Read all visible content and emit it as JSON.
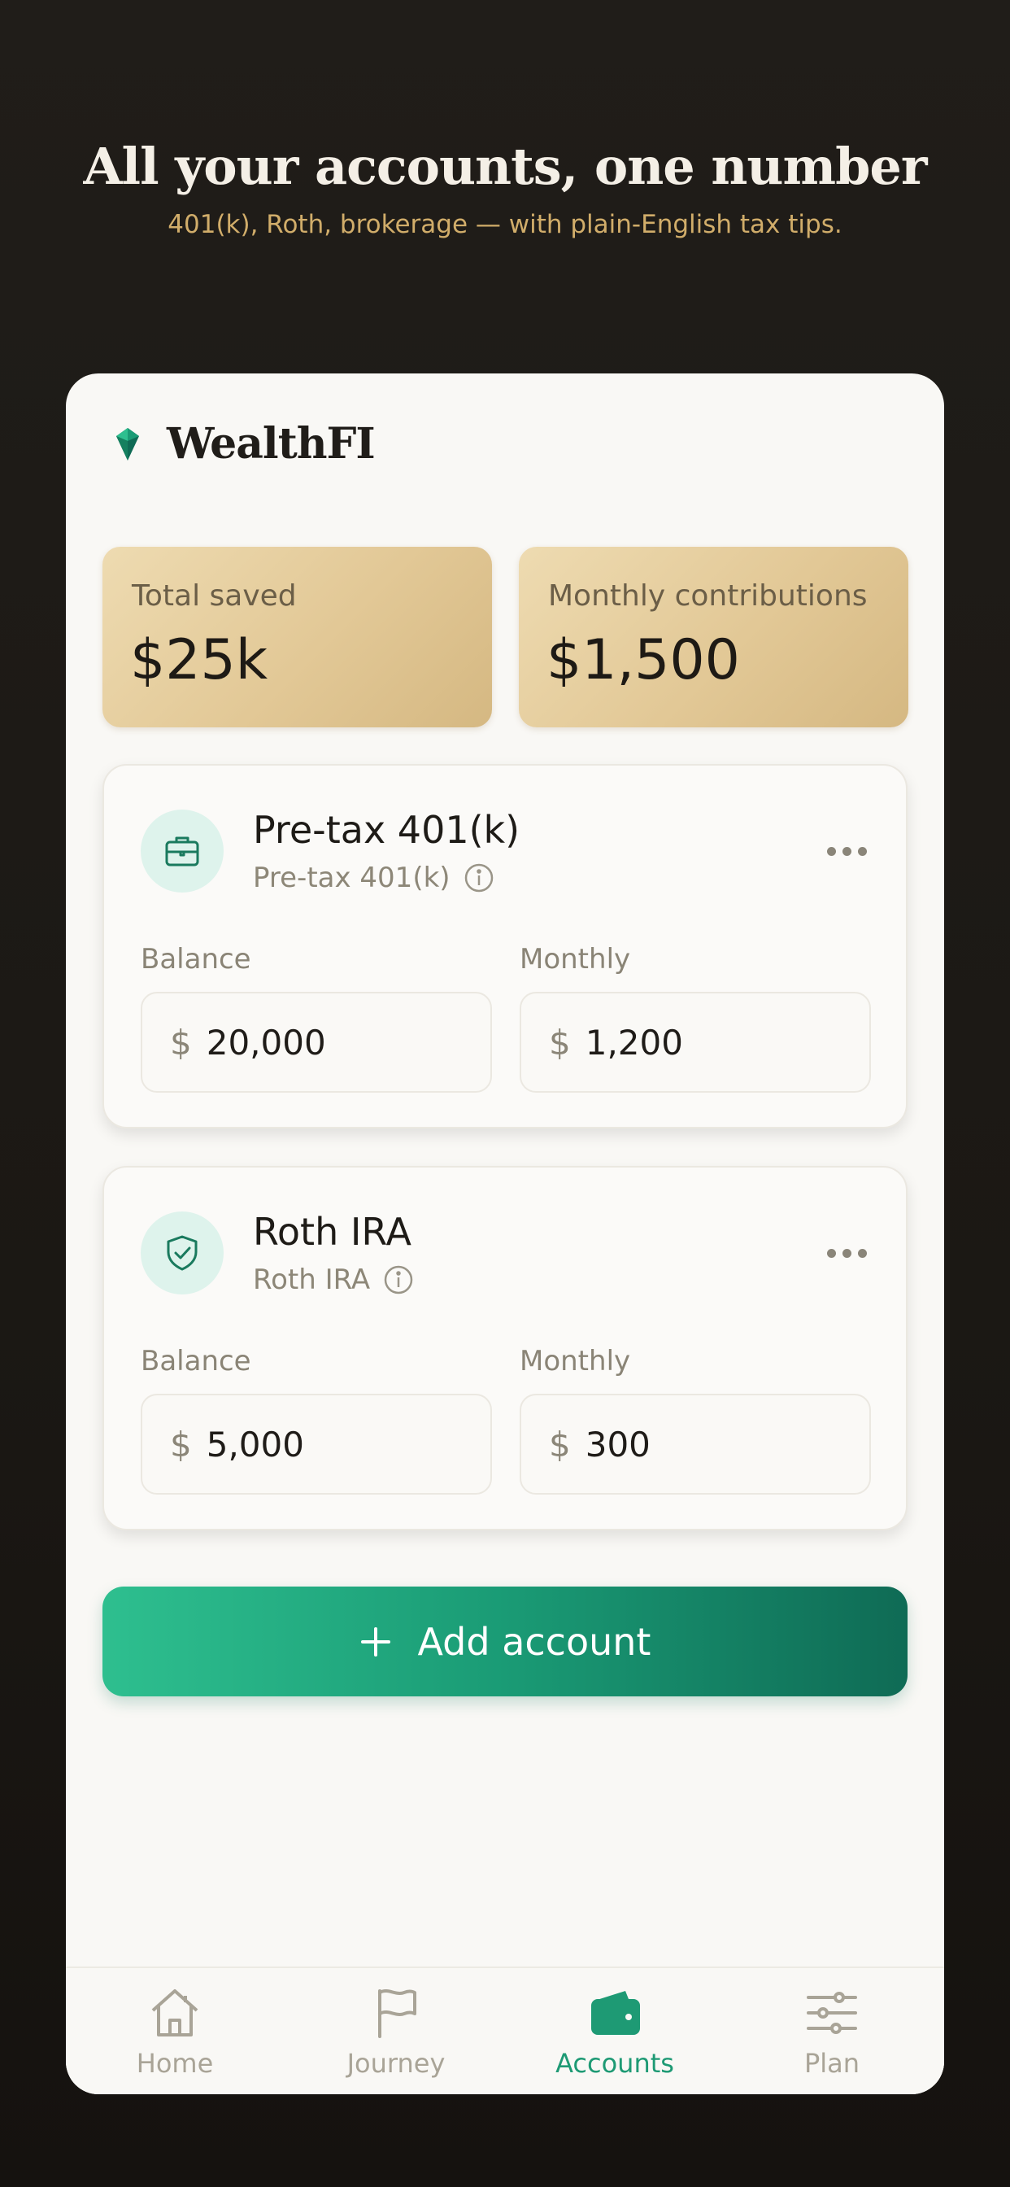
{
  "hero": {
    "title": "All your accounts, one number",
    "subtitle": "401(k), Roth, brokerage — with plain-English tax tips."
  },
  "app": {
    "brand": "WealthFI"
  },
  "summary": [
    {
      "label": "Total saved",
      "value": "$25k"
    },
    {
      "label": "Monthly contributions",
      "value": "$1,500"
    }
  ],
  "accounts": [
    {
      "name": "Pre-tax 401(k)",
      "type": "Pre-tax 401(k)",
      "icon": "briefcase-icon",
      "balance_label": "Balance",
      "balance": "20,000",
      "monthly_label": "Monthly",
      "monthly": "1,200",
      "currency": "$"
    },
    {
      "name": "Roth IRA",
      "type": "Roth IRA",
      "icon": "shield-check-icon",
      "balance_label": "Balance",
      "balance": "5,000",
      "monthly_label": "Monthly",
      "monthly": "300",
      "currency": "$"
    }
  ],
  "actions": {
    "add_account": "Add account"
  },
  "nav": [
    {
      "label": "Home",
      "icon": "home-icon",
      "active": false
    },
    {
      "label": "Journey",
      "icon": "flag-icon",
      "active": false
    },
    {
      "label": "Accounts",
      "icon": "wallet-icon",
      "active": true
    },
    {
      "label": "Plan",
      "icon": "sliders-icon",
      "active": false
    }
  ],
  "colors": {
    "accent": "#1e9a74",
    "gold": "#d1ad6a",
    "background": "#1b1814",
    "card": "#f9f8f5"
  }
}
